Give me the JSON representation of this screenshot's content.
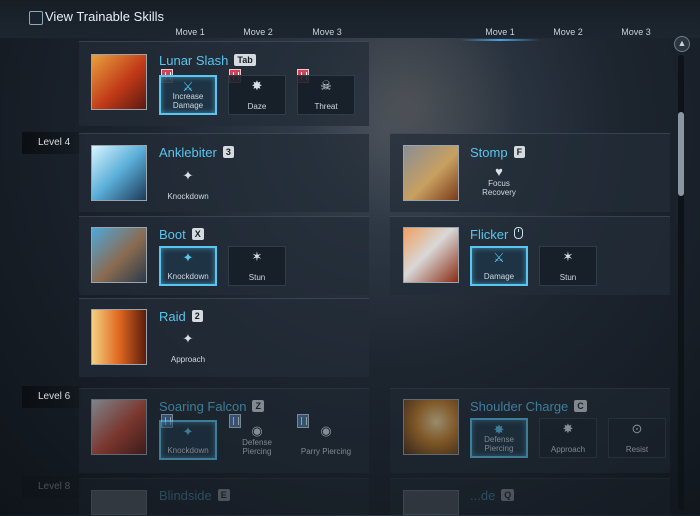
{
  "header": {
    "checkbox_label": "View Trainable Skills",
    "left_moves": [
      "Move 1",
      "Move 2",
      "Move 3"
    ],
    "right_moves": [
      "Move 1",
      "Move 2",
      "Move 3"
    ]
  },
  "levels": [
    "Level 4",
    "Level 6",
    "Level 8"
  ],
  "skills": {
    "lunar_slash": {
      "name": "Lunar Slash",
      "key": "Tab",
      "moves": [
        "Increase Damage",
        "Daze",
        "Threat"
      ]
    },
    "anklebiter": {
      "name": "Anklebiter",
      "key": "3",
      "moves": [
        "Knockdown"
      ]
    },
    "stomp": {
      "name": "Stomp",
      "key": "F",
      "moves": [
        "Focus Recovery"
      ]
    },
    "boot": {
      "name": "Boot",
      "key": "X",
      "moves": [
        "Knockdown",
        "Stun"
      ]
    },
    "flicker": {
      "name": "Flicker",
      "moves": [
        "Damage",
        "Stun"
      ]
    },
    "raid": {
      "name": "Raid",
      "key": "2",
      "moves": [
        "Approach"
      ]
    },
    "soaring_falcon": {
      "name": "Soaring Falcon",
      "key": "Z",
      "moves": [
        "Knockdown",
        "Defense Piercing",
        "Parry Piercing"
      ]
    },
    "shoulder_charge": {
      "name": "Shoulder Charge",
      "key": "C",
      "moves": [
        "Defense Piercing",
        "Approach",
        "Resist"
      ]
    },
    "blindside": {
      "name": "Blindside",
      "key": "E"
    },
    "partial_right": {
      "name": "...de",
      "key": "Q"
    }
  },
  "colors": {
    "accent": "#58c6f0",
    "book_red": "#cf4356",
    "book_blue": "#4d78a8"
  },
  "glyphs": {
    "sword": "⚔",
    "daze": "✸",
    "skull": "☠",
    "boot": "✦",
    "heart": "♥",
    "star": "✶",
    "target": "◉",
    "stop": "⊙",
    "up": "▲"
  }
}
